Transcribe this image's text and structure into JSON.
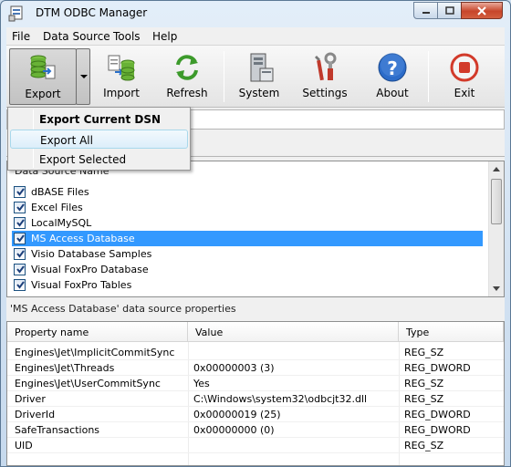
{
  "window": {
    "title": "DTM ODBC Manager"
  },
  "menu": [
    "File",
    "Data Source",
    "Tools",
    "Help"
  ],
  "toolbar": {
    "export": "Export",
    "import": "Import",
    "refresh": "Refresh",
    "system": "System",
    "settings": "Settings",
    "about": "About",
    "exit": "Exit"
  },
  "export_menu": {
    "items": [
      "Export Current DSN",
      "Export All",
      "Export Selected"
    ]
  },
  "dsn_list": {
    "header": "Data Source Name",
    "items": [
      {
        "label": "dBASE Files",
        "checked": true
      },
      {
        "label": "Excel Files",
        "checked": true
      },
      {
        "label": "LocalMySQL",
        "checked": true
      },
      {
        "label": "MS Access Database",
        "checked": true,
        "selected": true
      },
      {
        "label": "Visio Database Samples",
        "checked": true
      },
      {
        "label": "Visual FoxPro Database",
        "checked": true
      },
      {
        "label": "Visual FoxPro Tables",
        "checked": true
      }
    ]
  },
  "properties": {
    "title": "'MS Access Database' data source properties",
    "columns": [
      "Property name",
      "Value",
      "Type"
    ],
    "rows": [
      [
        "Engines\\Jet\\ImplicitCommitSync",
        "",
        "REG_SZ"
      ],
      [
        "Engines\\Jet\\Threads",
        "0x00000003 (3)",
        "REG_DWORD"
      ],
      [
        "Engines\\Jet\\UserCommitSync",
        "Yes",
        "REG_SZ"
      ],
      [
        "Driver",
        "C:\\Windows\\system32\\odbcjt32.dll",
        "REG_SZ"
      ],
      [
        "DriverId",
        "0x00000019 (25)",
        "REG_DWORD"
      ],
      [
        "SafeTransactions",
        "0x00000000 (0)",
        "REG_DWORD"
      ],
      [
        "UID",
        "",
        "REG_SZ"
      ]
    ]
  },
  "colors": {
    "selection": "#3399ff",
    "titlebar": "#c6d9ed",
    "close": "#c7452a"
  }
}
